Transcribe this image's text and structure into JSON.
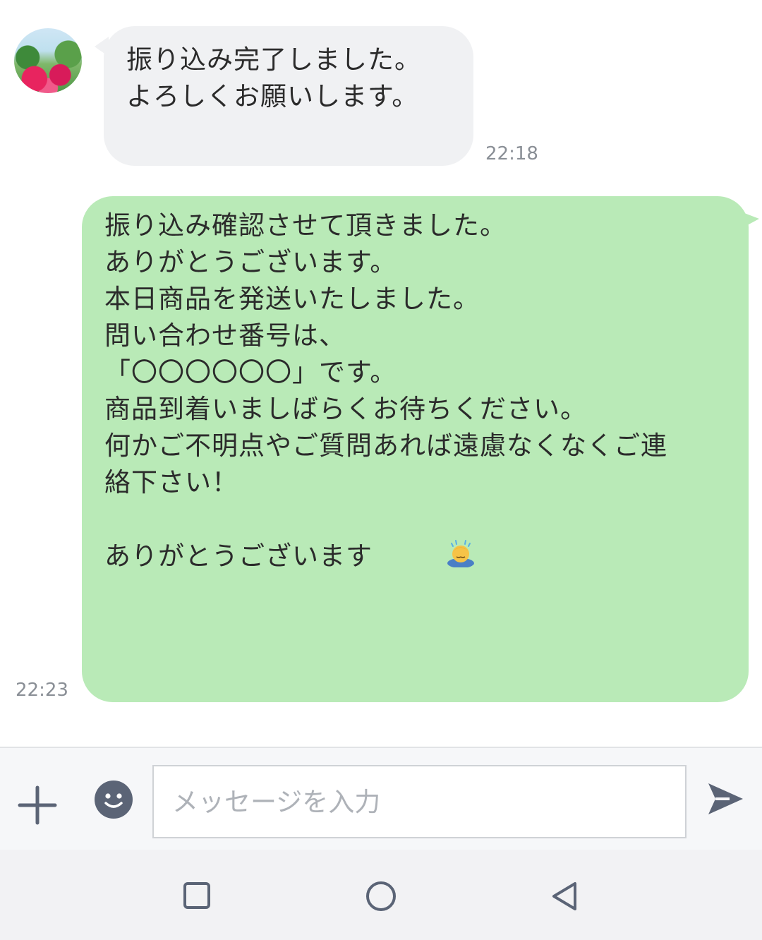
{
  "messages": [
    {
      "direction": "incoming",
      "lines": [
        "振り込み完了しました。",
        "よろしくお願いします。"
      ],
      "time": "22:18"
    },
    {
      "direction": "outgoing",
      "lines": [
        "振り込み確認させて頂きました。",
        "ありがとうございます。",
        "",
        "本日商品を発送いたしました。",
        "問い合わせ番号は、",
        "",
        "「〇〇〇〇〇〇」です。",
        "",
        "商品到着いましばらくお待ちください。",
        "何かご不明点やご質問あれば遠慮なくなくご連",
        "絡下さい！",
        "",
        "ありがとうございます"
      ],
      "trailing_icon": "bowing-person-emoji",
      "time": "22:23"
    }
  ],
  "composer": {
    "placeholder": "メッセージを入力",
    "value": "",
    "plus_icon": "plus-icon",
    "emoji_icon": "smiley-icon",
    "send_icon": "send-icon"
  },
  "navbar": {
    "buttons": [
      "recent-apps-icon",
      "home-icon",
      "back-icon"
    ]
  },
  "colors": {
    "incoming_bubble": "#f0f1f3",
    "outgoing_bubble": "#b9eab7",
    "icon": "#5b6476",
    "timestamp": "#8a8f96"
  }
}
